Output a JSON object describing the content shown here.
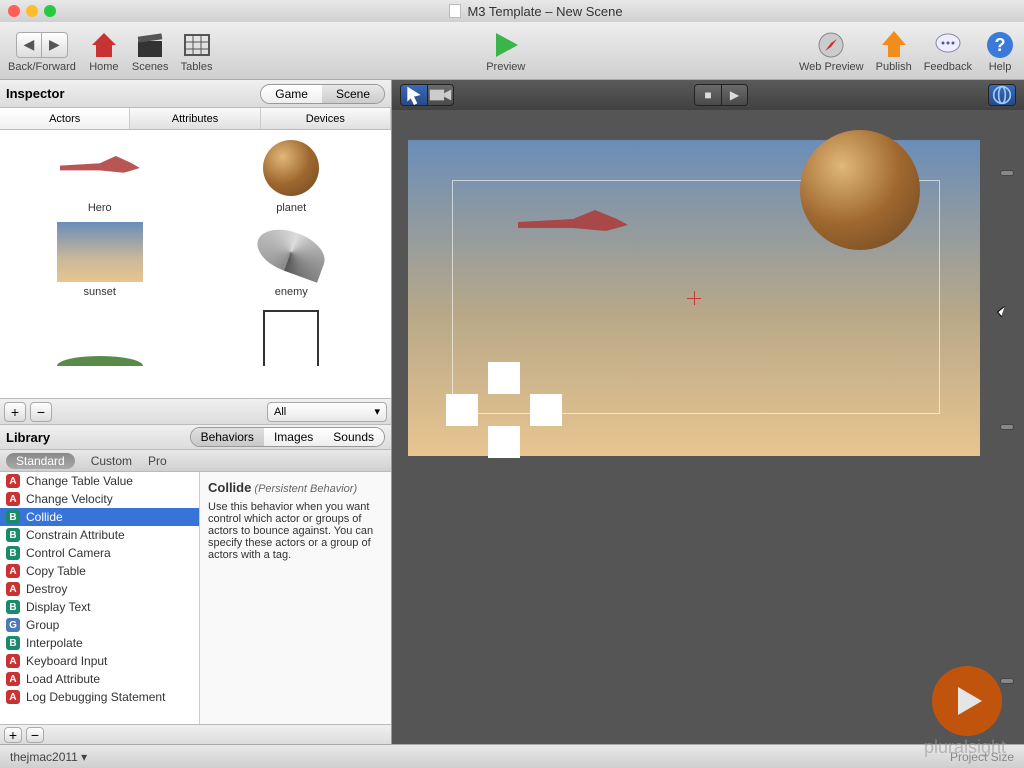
{
  "window": {
    "title": "M3 Template – New Scene"
  },
  "toolbar": {
    "backForward": "Back/Forward",
    "home": "Home",
    "scenes": "Scenes",
    "tables": "Tables",
    "preview": "Preview",
    "webPreview": "Web Preview",
    "publish": "Publish",
    "feedback": "Feedback",
    "help": "Help"
  },
  "inspector": {
    "title": "Inspector",
    "segGame": "Game",
    "segScene": "Scene",
    "tabs": {
      "actors": "Actors",
      "attributes": "Attributes",
      "devices": "Devices"
    },
    "actors": [
      {
        "name": "Hero"
      },
      {
        "name": "planet"
      },
      {
        "name": "sunset"
      },
      {
        "name": "enemy"
      }
    ],
    "filter": "All"
  },
  "library": {
    "title": "Library",
    "segs": {
      "behaviors": "Behaviors",
      "images": "Images",
      "sounds": "Sounds"
    },
    "types": {
      "standard": "Standard",
      "custom": "Custom",
      "pro": "Pro"
    },
    "behaviors": [
      {
        "badge": "A",
        "name": "Change Table Value"
      },
      {
        "badge": "A",
        "name": "Change Velocity"
      },
      {
        "badge": "B",
        "name": "Collide",
        "selected": true
      },
      {
        "badge": "B",
        "name": "Constrain Attribute"
      },
      {
        "badge": "B",
        "name": "Control Camera"
      },
      {
        "badge": "A",
        "name": "Copy Table"
      },
      {
        "badge": "A",
        "name": "Destroy"
      },
      {
        "badge": "B",
        "name": "Display Text"
      },
      {
        "badge": "G",
        "name": "Group"
      },
      {
        "badge": "B",
        "name": "Interpolate"
      },
      {
        "badge": "A",
        "name": "Keyboard Input"
      },
      {
        "badge": "A",
        "name": "Load Attribute"
      },
      {
        "badge": "A",
        "name": "Log Debugging Statement"
      }
    ],
    "desc": {
      "title": "Collide",
      "sub": "(Persistent Behavior)",
      "body": "Use this behavior when you want control which actor or groups of actors to bounce against. You can specify these actors or a group of actors with a tag."
    }
  },
  "bottom": {
    "user": "thejmac2011",
    "projectInfo": "Project Size"
  },
  "watermark": "pluralsight"
}
